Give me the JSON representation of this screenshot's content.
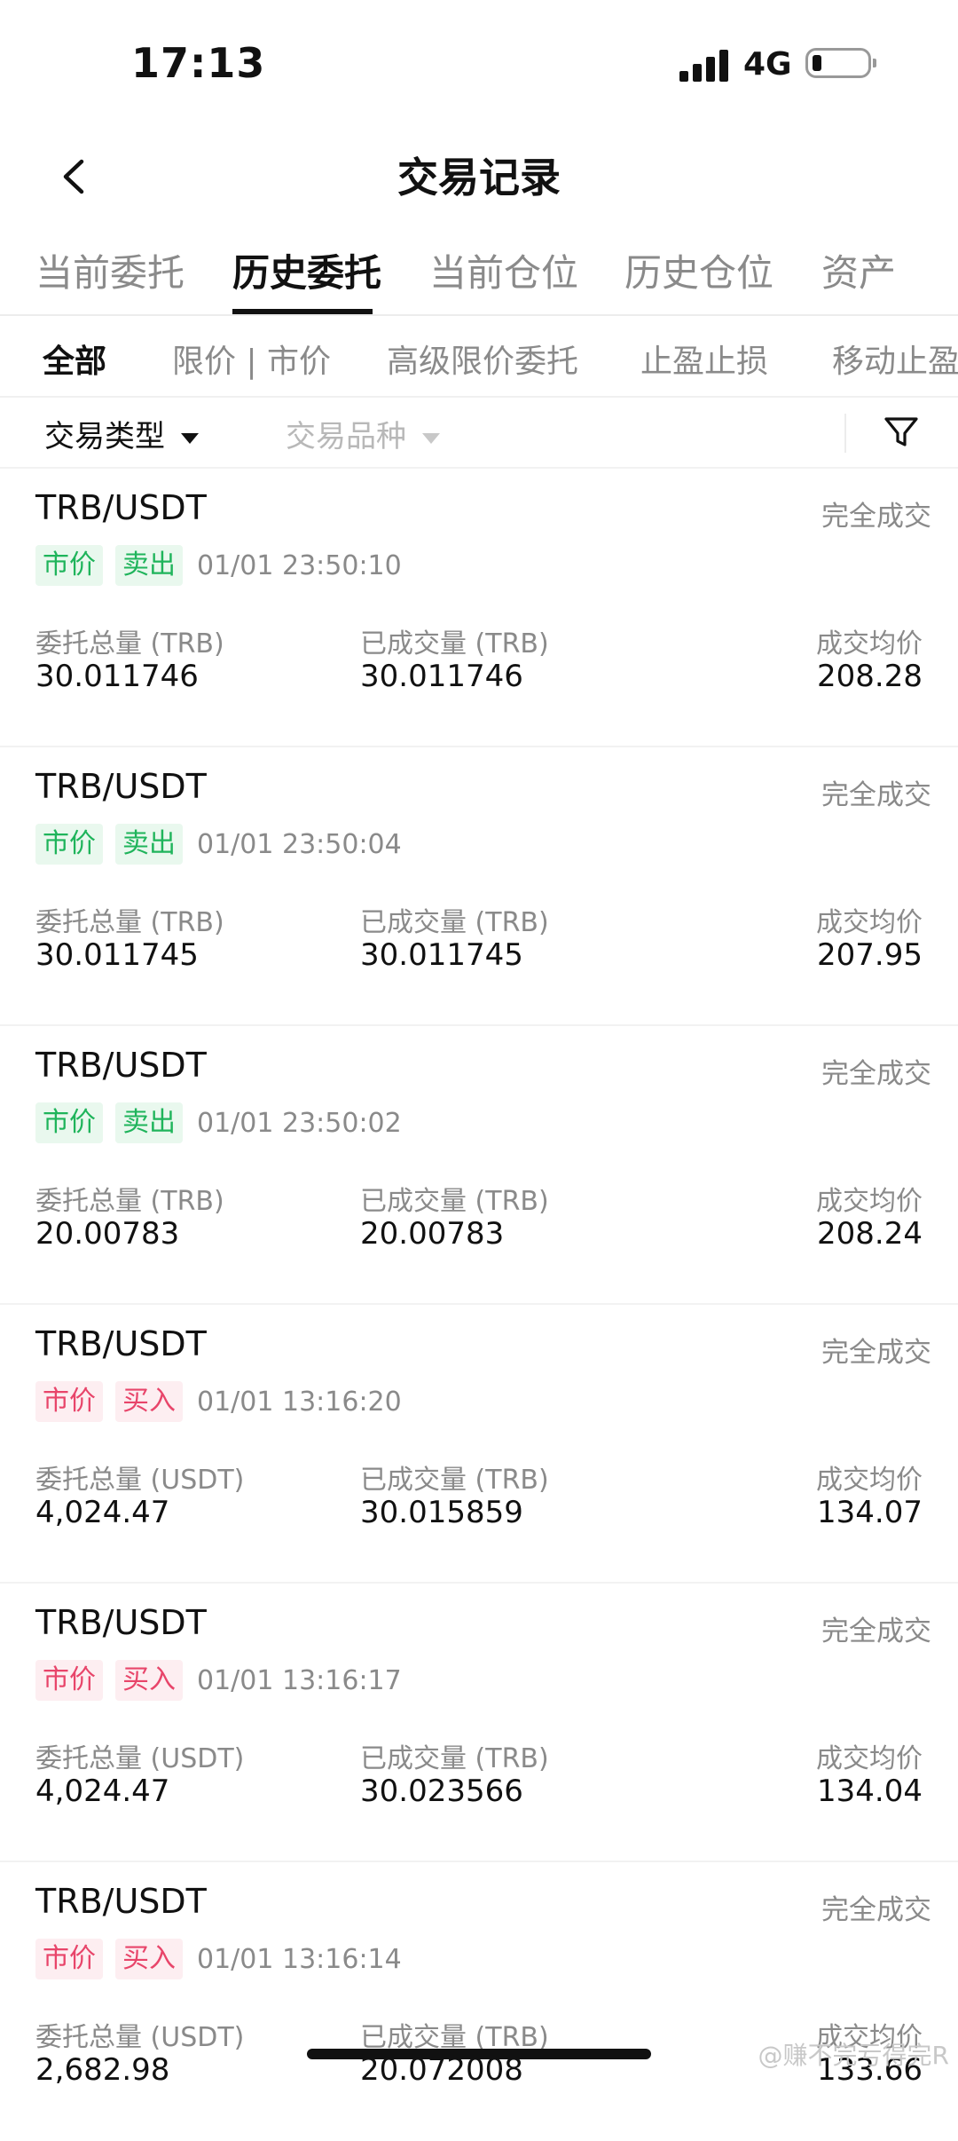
{
  "status_bar": {
    "time": "17:13",
    "network": "4G"
  },
  "header": {
    "title": "交易记录",
    "back_icon": "chevron-left-icon"
  },
  "main_tabs": [
    {
      "label": "当前委托",
      "active": false
    },
    {
      "label": "历史委托",
      "active": true
    },
    {
      "label": "当前仓位",
      "active": false
    },
    {
      "label": "历史仓位",
      "active": false
    },
    {
      "label": "资产",
      "active": false
    }
  ],
  "sub_tabs": [
    {
      "label": "全部",
      "active": true
    },
    {
      "label": "限价 | 市价",
      "active": false
    },
    {
      "label": "高级限价委托",
      "active": false
    },
    {
      "label": "止盈止损",
      "active": false
    },
    {
      "label": "移动止盈",
      "active": false
    }
  ],
  "filters": {
    "trade_type": "交易类型",
    "trade_symbol": "交易品种",
    "filter_icon": "funnel-icon"
  },
  "colors": {
    "sell": "#1fb45b",
    "sell_bg": "#e9f8ee",
    "buy": "#e8456a",
    "buy_bg": "#fdeef1"
  },
  "orders": [
    {
      "pair": "TRB/USDT",
      "status": "完全成交",
      "order_type": "市价",
      "side": "卖出",
      "side_kind": "sell",
      "time": "01/01 23:50:10",
      "total_label": "委托总量 (TRB)",
      "total": "30.011746",
      "filled_label": "已成交量 (TRB)",
      "filled": "30.011746",
      "avg_label": "成交均价",
      "avg_price": "208.28"
    },
    {
      "pair": "TRB/USDT",
      "status": "完全成交",
      "order_type": "市价",
      "side": "卖出",
      "side_kind": "sell",
      "time": "01/01 23:50:04",
      "total_label": "委托总量 (TRB)",
      "total": "30.011745",
      "filled_label": "已成交量 (TRB)",
      "filled": "30.011745",
      "avg_label": "成交均价",
      "avg_price": "207.95"
    },
    {
      "pair": "TRB/USDT",
      "status": "完全成交",
      "order_type": "市价",
      "side": "卖出",
      "side_kind": "sell",
      "time": "01/01 23:50:02",
      "total_label": "委托总量 (TRB)",
      "total": "20.00783",
      "filled_label": "已成交量 (TRB)",
      "filled": "20.00783",
      "avg_label": "成交均价",
      "avg_price": "208.24"
    },
    {
      "pair": "TRB/USDT",
      "status": "完全成交",
      "order_type": "市价",
      "side": "买入",
      "side_kind": "buy",
      "time": "01/01 13:16:20",
      "total_label": "委托总量 (USDT)",
      "total": "4,024.47",
      "filled_label": "已成交量 (TRB)",
      "filled": "30.015859",
      "avg_label": "成交均价",
      "avg_price": "134.07"
    },
    {
      "pair": "TRB/USDT",
      "status": "完全成交",
      "order_type": "市价",
      "side": "买入",
      "side_kind": "buy",
      "time": "01/01 13:16:17",
      "total_label": "委托总量 (USDT)",
      "total": "4,024.47",
      "filled_label": "已成交量 (TRB)",
      "filled": "30.023566",
      "avg_label": "成交均价",
      "avg_price": "134.04"
    },
    {
      "pair": "TRB/USDT",
      "status": "完全成交",
      "order_type": "市价",
      "side": "买入",
      "side_kind": "buy",
      "time": "01/01 13:16:14",
      "total_label": "委托总量 (USDT)",
      "total": "2,682.98",
      "filled_label": "已成交量 (TRB)",
      "filled": "20.072008",
      "avg_label": "成交均价",
      "avg_price": "133.66"
    }
  ],
  "watermark": "@赚不完亏得完R"
}
